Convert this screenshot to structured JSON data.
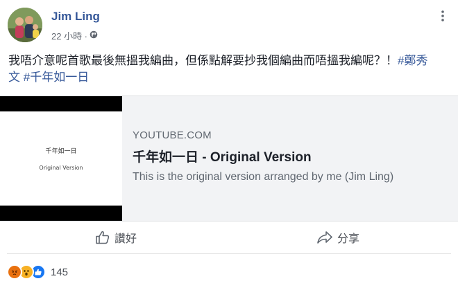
{
  "post": {
    "author": "Jim Ling",
    "time": "22 小時 · ",
    "privacy_icon": "globe-icon",
    "text": "我唔介意呢首歌最後無搵我編曲，但係點解要抄我個編曲而唔搵我編呢？！",
    "hashtags": [
      "#鄭秀文",
      "#千年如一日"
    ]
  },
  "link_preview": {
    "thumbnail_title": "千年如一日",
    "thumbnail_subtitle": "Original Version",
    "domain": "YOUTUBE.COM",
    "title": "千年如一日 - Original Version",
    "description": "This is the original version arranged by me (Jim Ling)"
  },
  "actions": {
    "like_label": "讚好",
    "share_label": "分享"
  },
  "reactions": {
    "icons": [
      "angry-icon",
      "wow-icon",
      "like-icon"
    ],
    "count": "145"
  },
  "colors": {
    "link_blue": "#365899",
    "like_blue": "#1877f2",
    "card_bg": "#f2f3f5"
  }
}
